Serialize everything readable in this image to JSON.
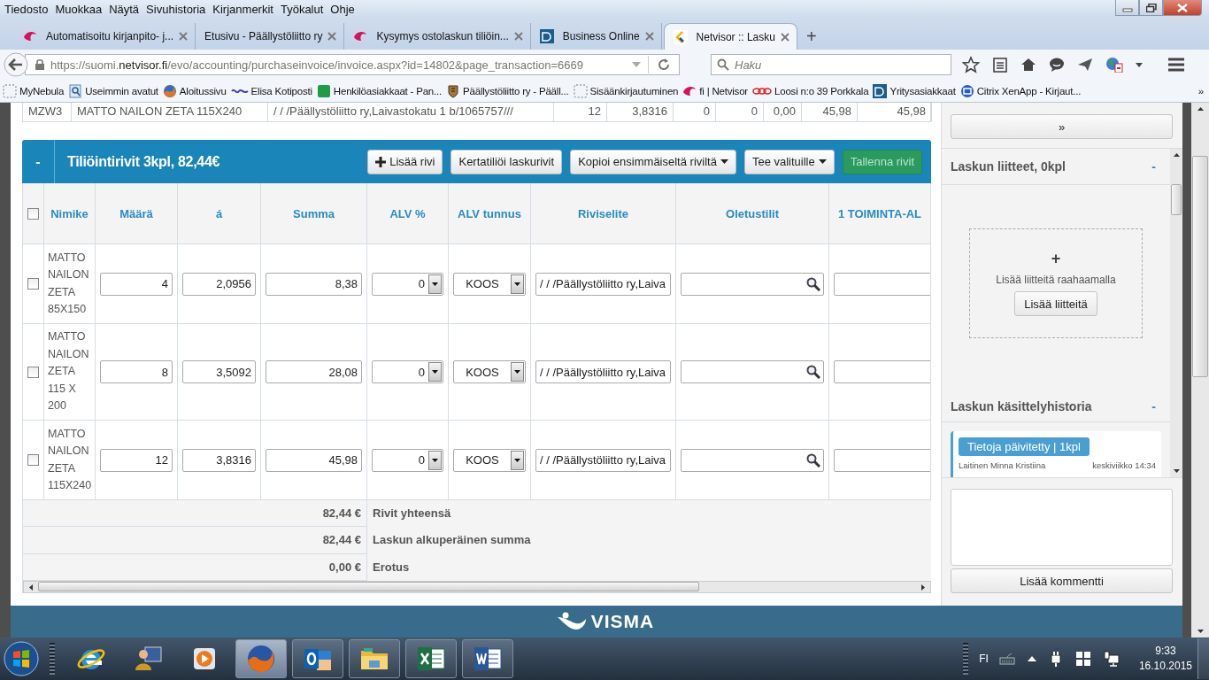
{
  "menu": [
    "Tiedosto",
    "Muokkaa",
    "Näytä",
    "Sivuhistoria",
    "Kirjanmerkit",
    "Työkalut",
    "Ohje"
  ],
  "tabs": [
    {
      "title": "Automatisoitu kirjanpito- j...",
      "kind": "swirl",
      "selected": false
    },
    {
      "title": "Etusivu - Päällystöliitto ry",
      "kind": "none",
      "selected": false
    },
    {
      "title": "Kysymys ostolaskun tiliöin...",
      "kind": "swirl",
      "selected": false
    },
    {
      "title": "Business Online",
      "kind": "square",
      "selected": false
    },
    {
      "title": "Netvisor :: Lasku",
      "kind": "netvisor",
      "selected": true
    }
  ],
  "new_tab": "+",
  "address": {
    "prefix": "https://suomi.",
    "domain": "netvisor.fi",
    "path": "/evo/accounting/purchaseinvoice/invoice.aspx?id=14802&page_transaction=6669"
  },
  "search": {
    "placeholder": "Haku"
  },
  "bookmarks": [
    {
      "label": "MyNebula",
      "kind": "blank"
    },
    {
      "label": "Useimmin avatut",
      "kind": "page"
    },
    {
      "label": "Aloitussivu",
      "kind": "fox"
    },
    {
      "label": "Elisa Kotiposti",
      "kind": "wave"
    },
    {
      "label": "Henkilöasiakkaat - Pan...",
      "kind": "green"
    },
    {
      "label": "Päällystöliitto ry - Pääll...",
      "kind": "crest"
    },
    {
      "label": "Sisäänkirjautuminen",
      "kind": "blank"
    },
    {
      "label": "fi | Netvisor",
      "kind": "swirl"
    },
    {
      "label": "Loosi n:o 39 Porkkala",
      "kind": "chain"
    },
    {
      "label": "Yritysasiakkaat",
      "kind": "square"
    },
    {
      "label": "Citrix XenApp - Kirjaut...",
      "kind": "circle"
    }
  ],
  "bookmarks_more": "»",
  "invoice_row": [
    "MZW3",
    "MATTO NAILON ZETA 115X240",
    "/ / /Päällystöliitto ry,Laivastokatu 1 b/1065757///",
    "12",
    "3,8316",
    "0",
    "0",
    "0,00",
    "45,98",
    "45,98"
  ],
  "panel": {
    "toggle": "-",
    "title": "Tiliöintirivit 3kpl, 82,44€",
    "buttons": [
      {
        "label": "Lisää rivi",
        "kind": "add"
      },
      {
        "label": "Kertatiliöi laskurivit",
        "kind": "plain"
      },
      {
        "label": "Kopioi ensimmäiseltä riviltä",
        "kind": "menu"
      },
      {
        "label": "Tee valituille",
        "kind": "menu"
      },
      {
        "label": "Tallenna rivit",
        "kind": "save"
      }
    ]
  },
  "header_checked": false,
  "columns": [
    "Nimike",
    "Määrä",
    "á",
    "Summa",
    "ALV %",
    "ALV tunnus",
    "Riviselite",
    "Oletustilit",
    "1 TOIMINTA-AL"
  ],
  "rows": [
    {
      "checked": false,
      "name": "MATTO NAILON ZETA 85X150",
      "quantity": "4",
      "unit_price": "2,0956",
      "sum": "8,38",
      "vat_percent": "0",
      "vat_code": "KOOS",
      "description": "/ / /Päällystöliitto ry,Laiva"
    },
    {
      "checked": false,
      "name": "MATTO NAILON ZETA 115 X 200",
      "quantity": "8",
      "unit_price": "3,5092",
      "sum": "28,08",
      "vat_percent": "0",
      "vat_code": "KOOS",
      "description": "/ / /Päällystöliitto ry,Laiva"
    },
    {
      "checked": false,
      "name": "MATTO NAILON ZETA 115X240",
      "quantity": "12",
      "unit_price": "3,8316",
      "sum": "45,98",
      "vat_percent": "0",
      "vat_code": "KOOS",
      "description": "/ / /Päällystöliitto ry,Laiva"
    }
  ],
  "totals": [
    {
      "amount": "82,44 €",
      "label": "Rivit yhteensä"
    },
    {
      "amount": "82,44 €",
      "label": "Laskun alkuperäinen summa"
    },
    {
      "amount": "0,00 €",
      "label": "Erotus"
    }
  ],
  "sidebar": {
    "expand": "»",
    "attachments": {
      "title": "Laskun liitteet, 0kpl",
      "toggle": "-",
      "plus": "+",
      "hint": "Lisää liitteitä raahaamalla",
      "button": "Lisää liitteitä"
    },
    "history": {
      "title": "Laskun käsittelyhistoria",
      "toggle": "-",
      "entries": [
        {
          "badge": "Tietoja päivitetty | 1kpl",
          "user": "Laitinen Minna Kristiina",
          "time": "keskiviikko 14:34"
        }
      ]
    },
    "comment": {
      "button": "Lisää kommentti"
    }
  },
  "footer": {
    "logo": "VISMA"
  },
  "taskbar": {
    "apps": [
      {
        "kind": "ie",
        "running": false,
        "active": false
      },
      {
        "kind": "person",
        "running": false,
        "active": false
      },
      {
        "kind": "media",
        "running": false,
        "active": false
      },
      {
        "kind": "firefox",
        "running": true,
        "active": true
      },
      {
        "kind": "outlook",
        "running": true,
        "active": false
      },
      {
        "kind": "folder",
        "running": true,
        "active": false
      },
      {
        "kind": "excel",
        "running": true,
        "active": false
      },
      {
        "kind": "word",
        "running": true,
        "active": false
      }
    ],
    "tray": {
      "language": "FI",
      "time": "9:33",
      "date": "16.10.2015"
    }
  }
}
